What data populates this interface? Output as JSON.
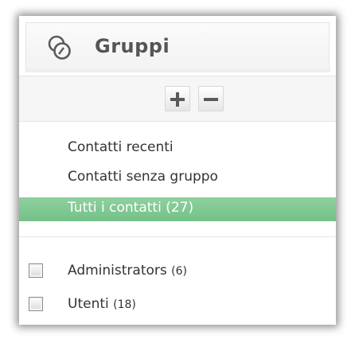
{
  "header": {
    "icon": "groups-icon",
    "title": "Gruppi"
  },
  "toolbar": {
    "add_icon": "plus-icon",
    "remove_icon": "minus-icon"
  },
  "nav": {
    "items": [
      {
        "label": "Contatti recenti"
      },
      {
        "label": "Contatti senza gruppo"
      },
      {
        "label": "Tutti i contatti (27)",
        "selected": true
      }
    ]
  },
  "groups": [
    {
      "name": "Administrators",
      "count": "(6)",
      "checked": false
    },
    {
      "name": "Utenti",
      "count": "(18)",
      "checked": false
    }
  ],
  "colors": {
    "selected_background": "#7cc48f",
    "title_text": "#555555",
    "body_text": "#333333"
  }
}
